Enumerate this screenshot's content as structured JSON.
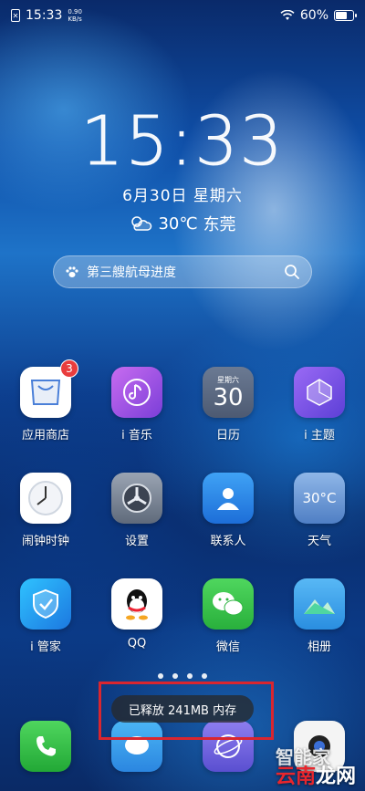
{
  "status_bar": {
    "time": "15:33",
    "net_speed_value": "0.90",
    "net_speed_unit": "KB/s",
    "battery_percent": "60%",
    "battery_level": 0.6
  },
  "lock": {
    "clock": "15:33",
    "date": "6月30日  星期六",
    "weather_temp": "30℃",
    "weather_city": "东莞"
  },
  "search": {
    "query": "第三艘航母进度"
  },
  "apps_row1": [
    {
      "label": "应用商店",
      "icon": "appstore-icon",
      "badge": "3"
    },
    {
      "label": "i 音乐",
      "icon": "music-icon"
    },
    {
      "label": "日历",
      "icon": "calendar-icon",
      "calendar_day": "30",
      "calendar_weekday": "星期六"
    },
    {
      "label": "i 主题",
      "icon": "theme-icon"
    }
  ],
  "apps_row2": [
    {
      "label": "闹钟时钟",
      "icon": "clock-icon"
    },
    {
      "label": "设置",
      "icon": "settings-icon"
    },
    {
      "label": "联系人",
      "icon": "contacts-icon"
    },
    {
      "label": "天气",
      "icon": "weather-icon",
      "temp": "30°C"
    }
  ],
  "apps_row3": [
    {
      "label": "i 管家",
      "icon": "shield-icon"
    },
    {
      "label": "QQ",
      "icon": "qq-icon"
    },
    {
      "label": "微信",
      "icon": "wechat-icon"
    },
    {
      "label": "相册",
      "icon": "gallery-icon"
    }
  ],
  "toast": "已释放 241MB 内存",
  "watermark": {
    "part1": "智能家",
    "part2": "云南",
    "part3": "龙网"
  },
  "colors": {
    "badge": "#e93d3d",
    "highlight": "#d9262f"
  }
}
